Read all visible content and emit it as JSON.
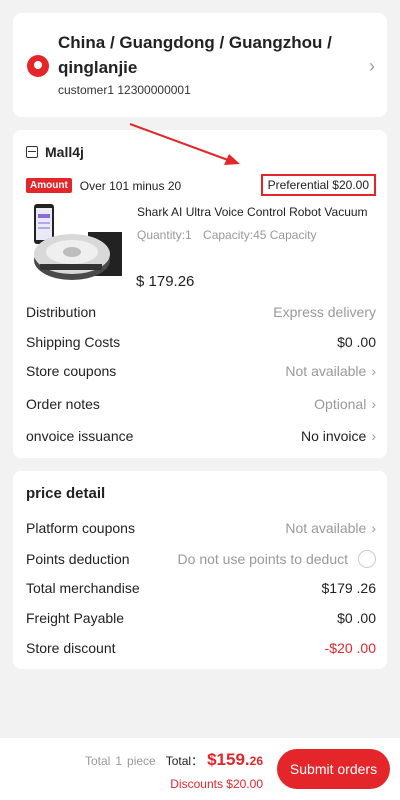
{
  "address": {
    "region": "China / Guangdong / Guangzhou / qinglanjie",
    "contact": "customer1 12300000001"
  },
  "order": {
    "shop_name": "Mall4j",
    "promo_badge": "Amount",
    "promo_text": "Over 101 minus 20",
    "preferential": "Preferential $20.00",
    "product": {
      "name": "Shark AI Ultra Voice Control Robot Vacuum",
      "quantity": "Quantity:1",
      "capacity": "Capacity:45 Capacity",
      "price": "$ 179.26"
    },
    "rows": [
      {
        "label": "Distribution",
        "value": "Express delivery"
      },
      {
        "label": "Shipping Costs",
        "value": "$0 .00"
      },
      {
        "label": "Store coupons",
        "value": "Not available"
      },
      {
        "label": "Order notes",
        "value": "Optional"
      },
      {
        "label": "onvoice issuance",
        "value": "No invoice"
      }
    ]
  },
  "price_detail": {
    "title": "price detail",
    "rows": [
      {
        "label": "Platform coupons",
        "value": "Not available"
      },
      {
        "label": "Points deduction",
        "value": "Do not use points to deduct"
      },
      {
        "label": "Total merchandise",
        "value": "$179 .26"
      },
      {
        "label": "Freight Payable",
        "value": "$0 .00"
      },
      {
        "label": "Store discount",
        "value": "-$20 .00"
      }
    ]
  },
  "footer": {
    "total_label": "Total",
    "count": "1",
    "unit": "piece",
    "total_prefix": "Total：",
    "total_main": "$159.",
    "total_cents": "26",
    "discounts": "Discounts $20.00",
    "submit": "Submit orders"
  },
  "colors": {
    "accent": "#e4262a",
    "muted": "#999999",
    "background": "#f2f2f2"
  },
  "icons": [
    "location-pin-icon",
    "chevron-right-icon",
    "shop-icon",
    "radio-icon",
    "arrow-annotation"
  ]
}
